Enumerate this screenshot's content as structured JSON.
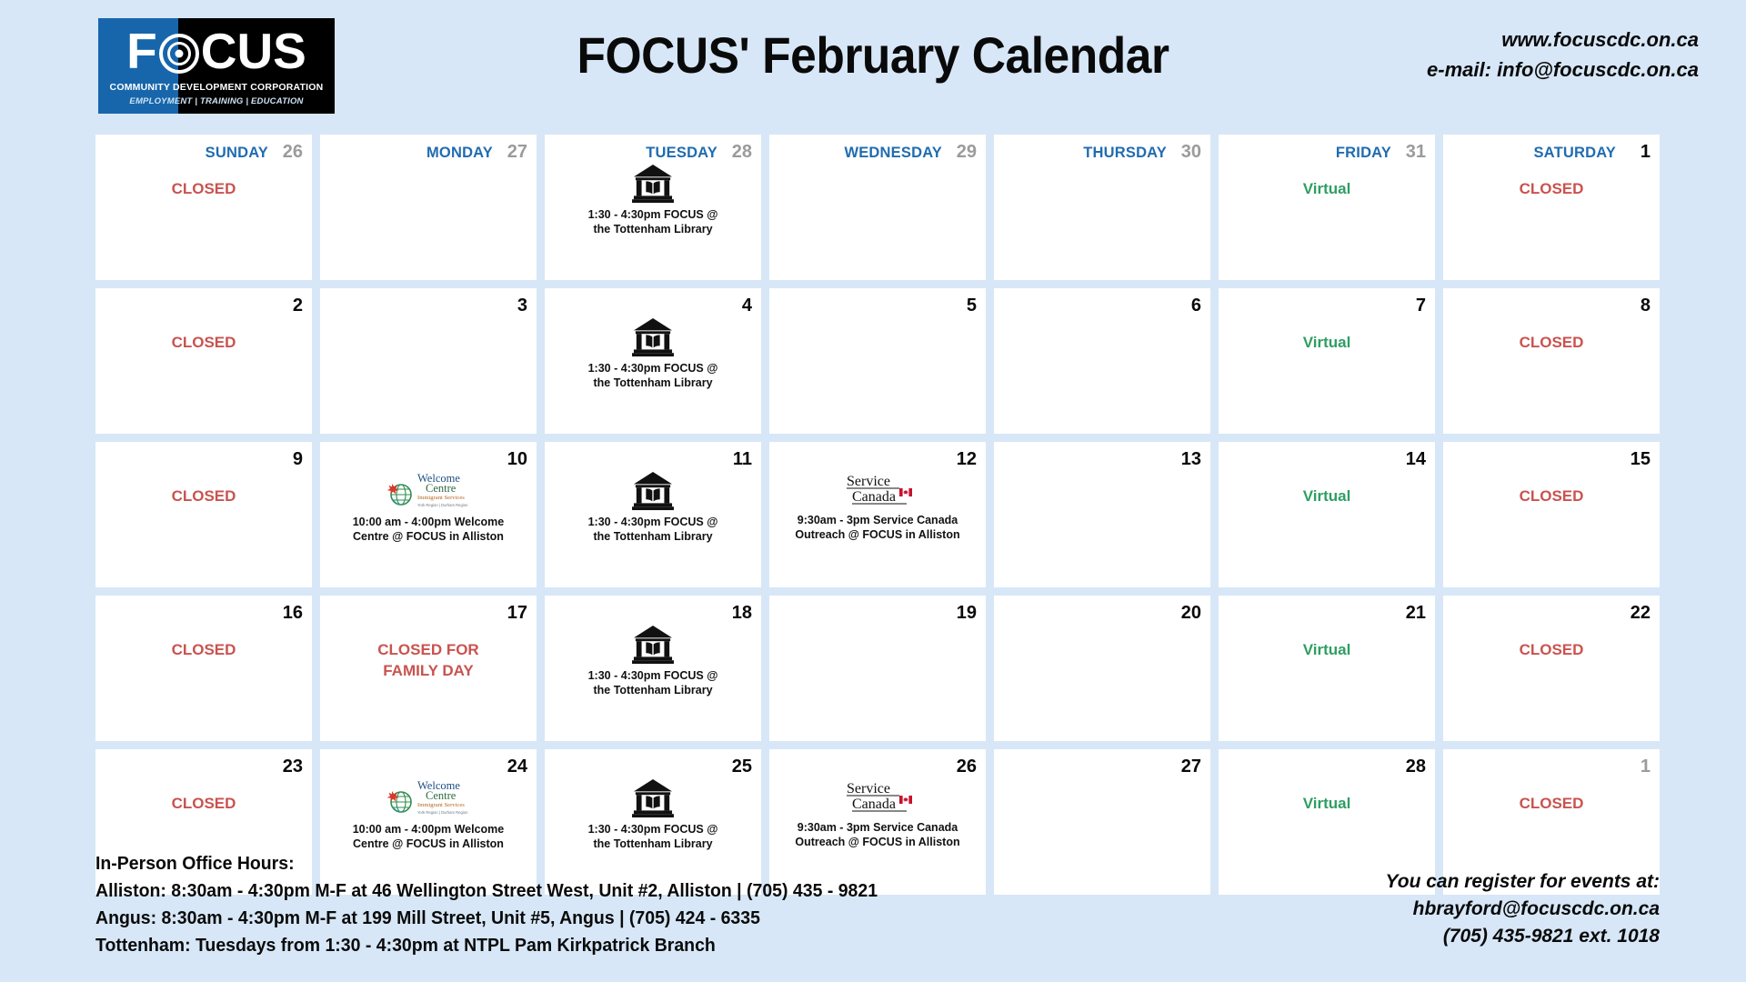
{
  "header": {
    "title": "FOCUS' February Calendar",
    "logo": {
      "brand": "FOCUS",
      "tagline": "COMMUNITY DEVELOPMENT CORPORATION",
      "subtagline": "EMPLOYMENT | TRAINING | EDUCATION"
    },
    "website": "www.focuscdc.on.ca",
    "email": "e-mail: info@focuscdc.on.ca"
  },
  "weekdays": [
    "SUNDAY",
    "MONDAY",
    "TUESDAY",
    "WEDNESDAY",
    "THURSDAY",
    "FRIDAY",
    "SATURDAY"
  ],
  "colors": {
    "background": "#d7e7f7",
    "cell": "#ffffff",
    "dayname": "#1f6cb0",
    "closed": "#c9534f",
    "virtual": "#2e9e62",
    "muted_date": "#9b9b9b",
    "logo_blue": "#1766ab"
  },
  "weeks": [
    [
      {
        "date": "26",
        "muted": true,
        "show_dayname": true,
        "status": "CLOSED",
        "status_type": "closed"
      },
      {
        "date": "27",
        "muted": true,
        "show_dayname": true
      },
      {
        "date": "28",
        "muted": true,
        "show_dayname": true,
        "icon": "library-icon",
        "event": "1:30 - 4:30pm FOCUS @\nthe Tottenham Library"
      },
      {
        "date": "29",
        "muted": true,
        "show_dayname": true
      },
      {
        "date": "30",
        "muted": true,
        "show_dayname": true
      },
      {
        "date": "31",
        "muted": true,
        "show_dayname": true,
        "status": "Virtual",
        "status_type": "virtual"
      },
      {
        "date": "1",
        "muted": false,
        "show_dayname": true,
        "status": "CLOSED",
        "status_type": "closed"
      }
    ],
    [
      {
        "date": "2",
        "muted": false,
        "status": "CLOSED",
        "status_type": "closed"
      },
      {
        "date": "3",
        "muted": false
      },
      {
        "date": "4",
        "muted": false,
        "icon": "library-icon",
        "event": "1:30 - 4:30pm FOCUS @\nthe Tottenham Library"
      },
      {
        "date": "5",
        "muted": false
      },
      {
        "date": "6",
        "muted": false
      },
      {
        "date": "7",
        "muted": false,
        "status": "Virtual",
        "status_type": "virtual"
      },
      {
        "date": "8",
        "muted": false,
        "status": "CLOSED",
        "status_type": "closed"
      }
    ],
    [
      {
        "date": "9",
        "muted": false,
        "status": "CLOSED",
        "status_type": "closed"
      },
      {
        "date": "10",
        "muted": false,
        "icon": "welcome-centre-logo",
        "event": "10:00 am - 4:00pm Welcome\nCentre @ FOCUS in Alliston"
      },
      {
        "date": "11",
        "muted": false,
        "icon": "library-icon",
        "event": "1:30 - 4:30pm FOCUS @\nthe Tottenham Library"
      },
      {
        "date": "12",
        "muted": false,
        "icon": "service-canada-logo",
        "event": "9:30am - 3pm Service Canada\nOutreach @ FOCUS in Alliston"
      },
      {
        "date": "13",
        "muted": false
      },
      {
        "date": "14",
        "muted": false,
        "status": "Virtual",
        "status_type": "virtual"
      },
      {
        "date": "15",
        "muted": false,
        "status": "CLOSED",
        "status_type": "closed"
      }
    ],
    [
      {
        "date": "16",
        "muted": false,
        "status": "CLOSED",
        "status_type": "closed"
      },
      {
        "date": "17",
        "muted": false,
        "status": "CLOSED FOR\nFAMILY DAY",
        "status_type": "closed"
      },
      {
        "date": "18",
        "muted": false,
        "icon": "library-icon",
        "event": "1:30 - 4:30pm FOCUS @\nthe Tottenham Library"
      },
      {
        "date": "19",
        "muted": false
      },
      {
        "date": "20",
        "muted": false
      },
      {
        "date": "21",
        "muted": false,
        "status": "Virtual",
        "status_type": "virtual"
      },
      {
        "date": "22",
        "muted": false,
        "status": "CLOSED",
        "status_type": "closed"
      }
    ],
    [
      {
        "date": "23",
        "muted": false,
        "status": "CLOSED",
        "status_type": "closed"
      },
      {
        "date": "24",
        "muted": false,
        "icon": "welcome-centre-logo",
        "event": "10:00 am - 4:00pm Welcome\nCentre @ FOCUS in Alliston"
      },
      {
        "date": "25",
        "muted": false,
        "icon": "library-icon",
        "event": "1:30 - 4:30pm FOCUS @\nthe Tottenham Library"
      },
      {
        "date": "26",
        "muted": false,
        "icon": "service-canada-logo",
        "event": "9:30am - 3pm Service Canada\nOutreach @ FOCUS in Alliston"
      },
      {
        "date": "27",
        "muted": false
      },
      {
        "date": "28",
        "muted": false,
        "status": "Virtual",
        "status_type": "virtual"
      },
      {
        "date": "1",
        "muted": true,
        "status": "CLOSED",
        "status_type": "closed"
      }
    ]
  ],
  "logos": {
    "welcome_centre": {
      "line1": "Welcome",
      "line2": "Centre",
      "line3": "Immigrant Services",
      "line4": "York Region | Durham Region"
    },
    "service_canada": {
      "line1": "Service",
      "line2": "Canada"
    }
  },
  "footer": {
    "hours": "In-Person Office Hours:\nAlliston: 8:30am - 4:30pm M-F at 46 Wellington Street West, Unit #2, Alliston | (705) 435 - 9821\nAngus: 8:30am - 4:30pm M-F at 199 Mill Street, Unit #5, Angus | (705) 424 - 6335\nTottenham: Tuesdays from 1:30 - 4:30pm at NTPL Pam Kirkpatrick Branch",
    "register": "You can register for events at:\nhbrayford@focuscdc.on.ca\n(705) 435-9821 ext. 1018"
  }
}
